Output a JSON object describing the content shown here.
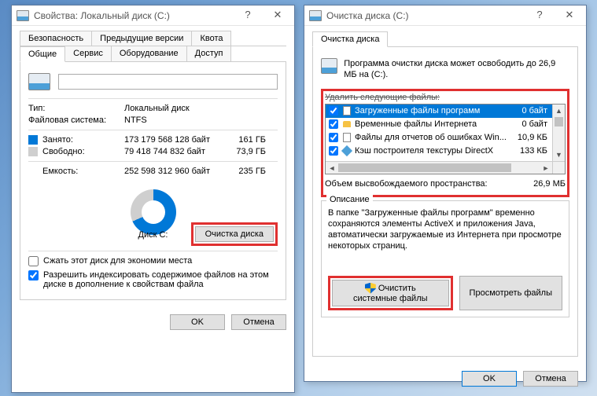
{
  "left": {
    "title": "Свойства: Локальный диск (C:)",
    "tabs_row1": [
      "Безопасность",
      "Предыдущие версии",
      "Квота"
    ],
    "tabs_row2": [
      "Общие",
      "Сервис",
      "Оборудование",
      "Доступ"
    ],
    "type_label": "Тип:",
    "type_value": "Локальный диск",
    "fs_label": "Файловая система:",
    "fs_value": "NTFS",
    "used_label": "Занято:",
    "used_bytes": "173 179 568 128 байт",
    "used_gb": "161 ГБ",
    "free_label": "Свободно:",
    "free_bytes": "79 418 744 832 байт",
    "free_gb": "73,9 ГБ",
    "cap_label": "Емкость:",
    "cap_bytes": "252 598 312 960 байт",
    "cap_gb": "235 ГБ",
    "disk_label": "Диск C:",
    "cleanup_btn": "Очистка диска",
    "compress_label": "Сжать этот диск для экономии места",
    "index_label": "Разрешить индексировать содержимое файлов на этом диске в дополнение к свойствам файла",
    "ok": "OK",
    "cancel": "Отмена"
  },
  "right": {
    "title": "Очистка диска  (C:)",
    "tab": "Очистка диска",
    "info": "Программа очистки диска может освободить до 26,9 МБ на  (C:).",
    "list_caption": "Удалить следующие файлы:",
    "files": [
      {
        "label": "Загруженные файлы программ",
        "size": "0 байт",
        "checked": true,
        "selected": true,
        "icon": "page"
      },
      {
        "label": "Временные файлы Интернета",
        "size": "0 байт",
        "checked": true,
        "selected": false,
        "icon": "lock"
      },
      {
        "label": "Файлы для отчетов об ошибках Win...",
        "size": "10,9 КБ",
        "checked": true,
        "selected": false,
        "icon": "page"
      },
      {
        "label": "Кэш построителя текстуры DirectX",
        "size": "133 КБ",
        "checked": true,
        "selected": false,
        "icon": "cube"
      }
    ],
    "free_label": "Объем высвобождаемого пространства:",
    "free_value": "26,9 МБ",
    "desc_title": "Описание",
    "desc_text": "В папке \"Загруженные файлы программ\" временно сохраняются элементы ActiveX и приложения Java, автоматически загружаемые из Интернета при просмотре некоторых страниц.",
    "clean_sys": "Очистить системные файлы",
    "view_files": "Просмотреть файлы",
    "ok": "OK",
    "cancel": "Отмена"
  }
}
